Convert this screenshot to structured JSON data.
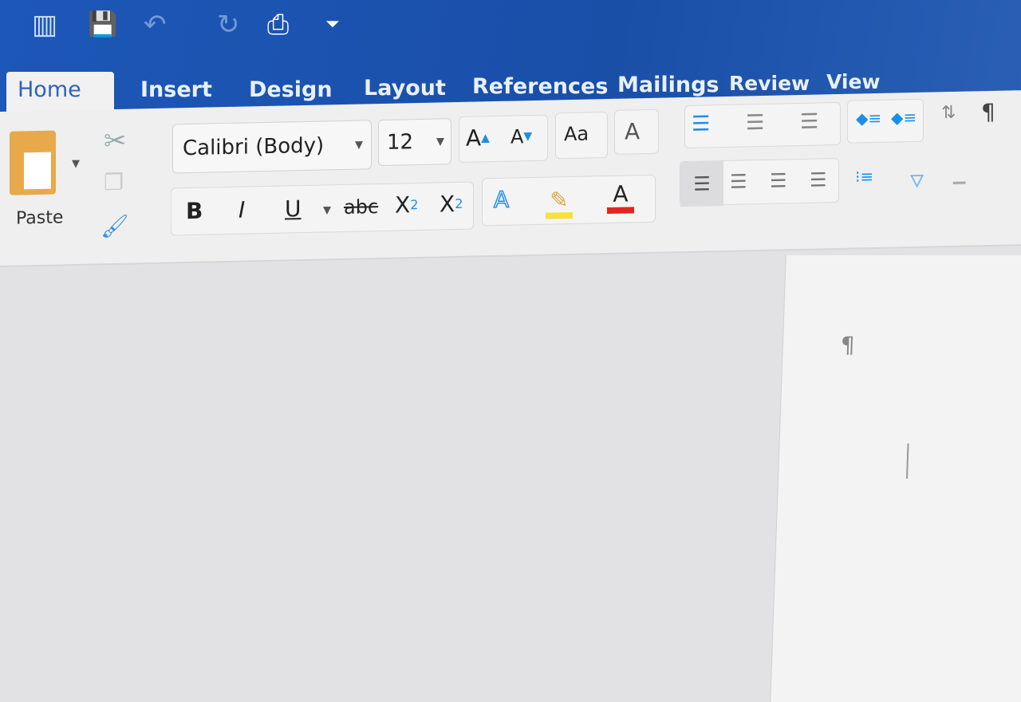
{
  "quick_access": [
    {
      "icon": "sidebar-icon",
      "glyph": "▥"
    },
    {
      "icon": "save-icon",
      "glyph": "💾"
    },
    {
      "icon": "undo-icon",
      "glyph": "↶"
    },
    {
      "icon": "redo-icon",
      "glyph": "↻"
    },
    {
      "icon": "print-icon",
      "glyph": "⎙"
    },
    {
      "icon": "customize-icon",
      "glyph": "⏷"
    }
  ],
  "tabs": [
    "Home",
    "Insert",
    "Design",
    "Layout",
    "References",
    "Mailings",
    "Review",
    "View"
  ],
  "clipboard": {
    "paste": "Paste"
  },
  "font": {
    "name": "Calibri (Body)",
    "size": "12"
  },
  "format": {
    "bold": "B",
    "italic": "I",
    "underline": "U",
    "strike": "abc",
    "sub": "X",
    "sub2": "2",
    "sup": "X",
    "sup2": "2",
    "grow": "A",
    "shrink": "A",
    "case": "Aa",
    "clear": "A",
    "effects": "A",
    "color": "A"
  },
  "colors": {
    "accent": "#1d57b8",
    "highlight": "#f5e23a",
    "font_color": "#e0261f",
    "icon_blue": "#1e8de8"
  },
  "paragraph": {
    "pilcrow": "¶"
  }
}
